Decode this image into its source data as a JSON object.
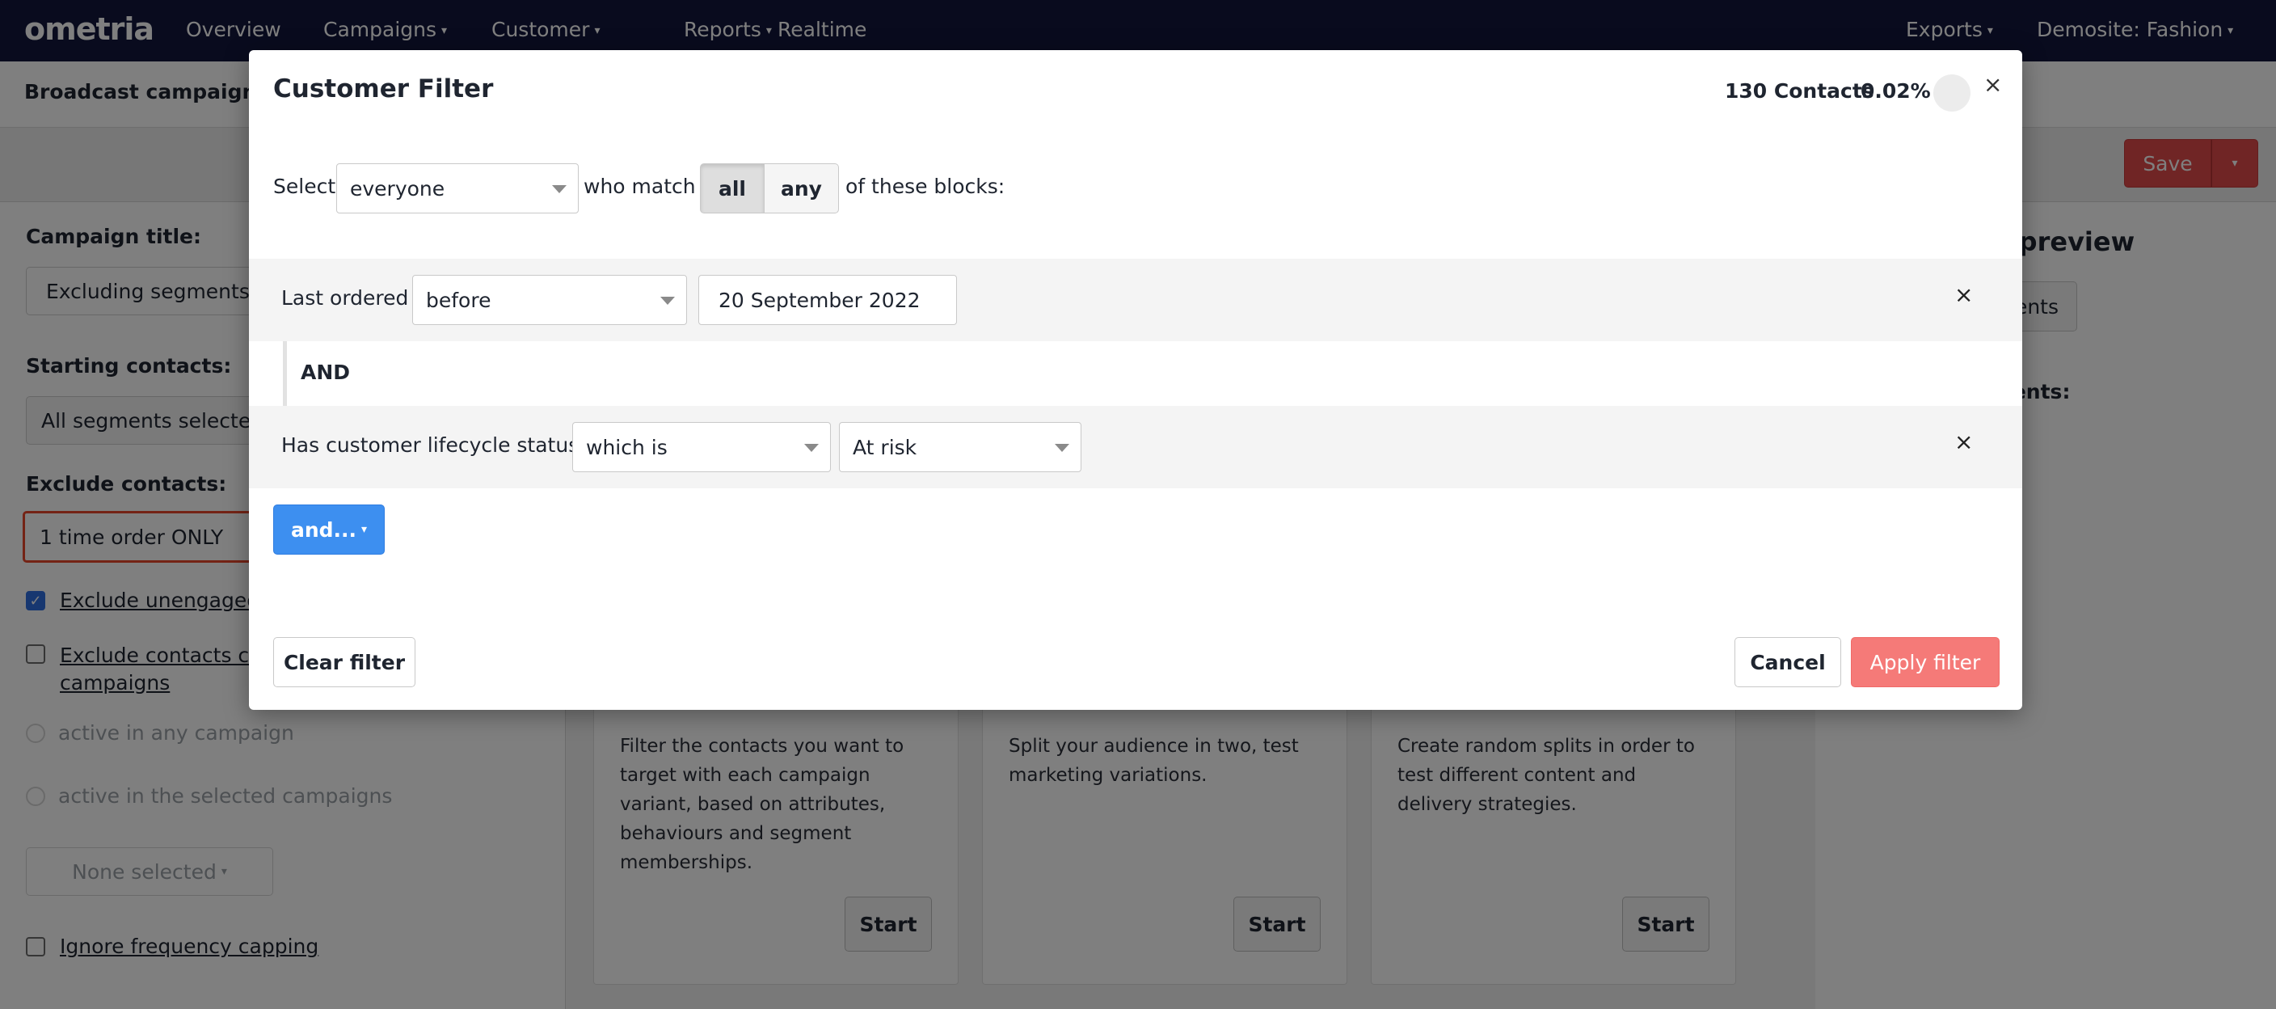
{
  "nav": {
    "logo": "ometria",
    "items": [
      "Overview",
      "Campaigns",
      "Customer",
      "Reports",
      "Realtime"
    ],
    "exports": "Exports",
    "account": "Demosite: Fashion",
    "caret": "▾"
  },
  "page": {
    "breadcrumb": "Broadcast campaigns",
    "save_label": "Save",
    "save_caret": "▾",
    "campaign_title_label": "Campaign title:",
    "campaign_title_value": "Excluding segments",
    "starting_contacts_label": "Starting contacts:",
    "starting_contacts_value": "All segments selected",
    "exclude_contacts_label": "Exclude contacts:",
    "exclude_contacts_value": "1 time order ONLY",
    "exclude_unengaged": "Exclude unengaged",
    "exclude_current_line1": "Exclude contacts cu",
    "exclude_current_line2": "campaigns",
    "radio_any": "active in any campaign",
    "radio_selected": "active in the selected campaigns",
    "none_selected": "None selected",
    "none_caret": "▾",
    "ignore_frequency": "Ignore frequency capping",
    "cards": [
      {
        "text": "Filter the contacts you want to target with each campaign variant, based on attributes, behaviours and segment memberships.",
        "button": "Start"
      },
      {
        "text": "Split your audience in two, test marketing variations.",
        "button": "Start"
      },
      {
        "text": "Create random splits in order to test different content and delivery strategies.",
        "button": "Start"
      }
    ],
    "preview_title": "cture preview",
    "preview_button": "ents",
    "recipients_label": "cipients:"
  },
  "modal": {
    "title": "Customer Filter",
    "contacts_count": "130 Contacts",
    "contacts_pct": "0.02%",
    "close": "×",
    "select_label": "Select",
    "select_value": "everyone",
    "who_match": "who match",
    "match_all": "all",
    "match_any": "any",
    "of_blocks": "of these blocks:",
    "block1": {
      "label": "Last ordered",
      "operator": "before",
      "date": "20 September 2022",
      "remove": "×"
    },
    "and_label": "AND",
    "block2": {
      "label": "Has customer lifecycle status",
      "operator": "which is",
      "value": "At risk",
      "remove": "×"
    },
    "and_button": "and...",
    "and_caret": "▾",
    "clear_filter": "Clear filter",
    "cancel": "Cancel",
    "apply_filter": "Apply filter"
  },
  "colors": {
    "nav_bg": "#12173d",
    "primary_blue": "#3d8ff0",
    "apply_red": "#f57a78",
    "save_red": "#e04a4a",
    "focus_red": "#e8472a"
  }
}
